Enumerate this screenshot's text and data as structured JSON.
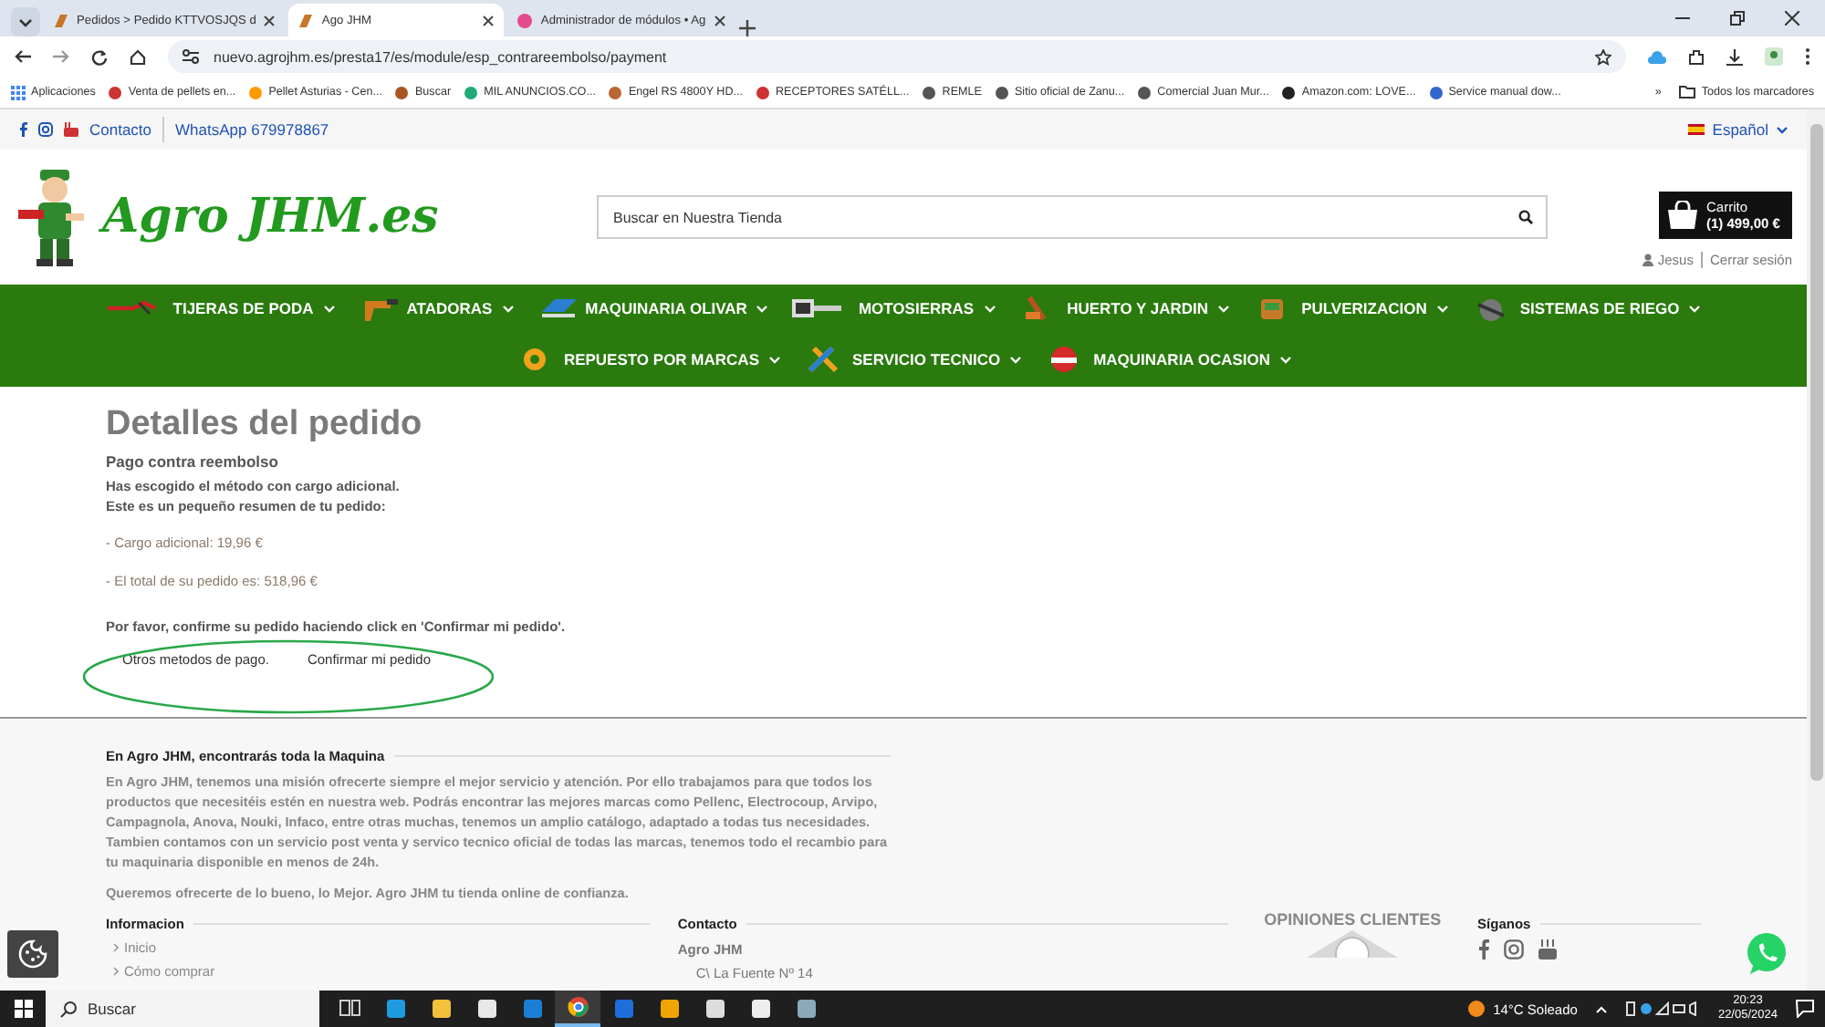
{
  "browser": {
    "tabs": [
      {
        "title": "Pedidos > Pedido KTTVOSJQS d",
        "selected": false
      },
      {
        "title": "Ago JHM",
        "selected": true
      },
      {
        "title": "Administrador de módulos • Ag",
        "selected": false
      }
    ],
    "url": "nuevo.agrojhm.es/presta17/es/module/esp_contrareembolso/payment",
    "bookmarks": [
      "Aplicaciones",
      "Venta de pellets en...",
      "Pellet Asturias - Cen...",
      "Buscar",
      "MIL ANUNCIOS.CO...",
      "Engel RS 4800Y HD...",
      "RECEPTORES SATÉLL...",
      "REMLE",
      "Sitio oficial de Zanu...",
      "Comercial Juan Mur...",
      "Amazon.com: LOVE...",
      "Service manual dow..."
    ],
    "bookmarks_more": "»",
    "all_bookmarks": "Todos los marcadores"
  },
  "topbar": {
    "contact": "Contacto",
    "whatsapp": "WhatsApp 679978867",
    "language": "Español"
  },
  "header": {
    "logo": "Agro JHM.es",
    "search": {
      "placeholder": "Buscar en Nuestra Tienda"
    },
    "cart": {
      "label": "Carrito",
      "summary": "(1) 499,00 €"
    },
    "user": "Jesus",
    "logout": "Cerrar sesión"
  },
  "nav_rows": [
    {
      "items": [
        "TIJERAS DE PODA",
        "ATADORAS",
        "MAQUINARIA OLIVAR",
        "MOTOSIERRAS",
        "HUERTO Y JARDIN",
        "PULVERIZACION",
        "SISTEMAS DE RIEGO"
      ]
    },
    {
      "items": [
        "REPUESTO POR MARCAS",
        "SERVICIO TECNICO",
        "MAQUINARIA OCASION"
      ]
    }
  ],
  "order": {
    "title": "Detalles del pedido",
    "subtitle": "Pago contra reembolso",
    "intro": [
      "Has escogido el método con cargo adicional.",
      "Este es un pequeño resumen de tu pedido:"
    ],
    "lines": [
      "- Cargo adicional: 19,96 €",
      "- El total de su pedido es: 518,96 €"
    ],
    "prompt": "Por favor, confirme su pedido haciendo click en 'Confirmar mi pedido'.",
    "actions": [
      "Otros metodos de pago.",
      "Confirmar mi pedido"
    ]
  },
  "footer": {
    "about_title": "En Agro JHM, encontrarás toda la Maquina",
    "about": [
      "En Agro JHM, tenemos una misión ofrecerte siempre el mejor servicio y atención. Por ello trabajamos para que todos los productos que necesitéis estén en nuestra web. Podrás encontrar las mejores marcas como Pellenc, Electrocoup, Arvipo, Campagnola, Anova, Nouki, Infaco, entre otras muchas, tenemos un amplio catálogo, adaptado a todas tus necesidades. Tambien contamos con un servicio post venta y servico tecnico oficial de todas las marcas, tenemos todo el recambio para tu maquinaria disponible en menos de 24h.",
      "Queremos ofrecerte de lo bueno, lo Mejor. Agro JHM tu tienda online de confianza."
    ],
    "info_title": "Informacion",
    "info_links": [
      "Inicio",
      "Cómo comprar"
    ],
    "contact_title": "Contacto",
    "contact_name": "Agro JHM",
    "contact_address": "C\\ La Fuente Nº 14",
    "reviews_title": "OPINIONES CLIENTES",
    "follow_title": "Síganos"
  },
  "taskbar": {
    "search": "Buscar",
    "apps": [
      {
        "selected": false
      },
      {
        "selected": false
      },
      {
        "selected": false
      },
      {
        "selected": false
      },
      {
        "selected": false
      },
      {
        "selected": true
      },
      {
        "selected": false
      },
      {
        "selected": false
      },
      {
        "selected": false
      },
      {
        "selected": false
      },
      {
        "selected": false
      }
    ],
    "weather": "14°C  Soleado",
    "time": "20:23",
    "date": "22/05/2024"
  }
}
